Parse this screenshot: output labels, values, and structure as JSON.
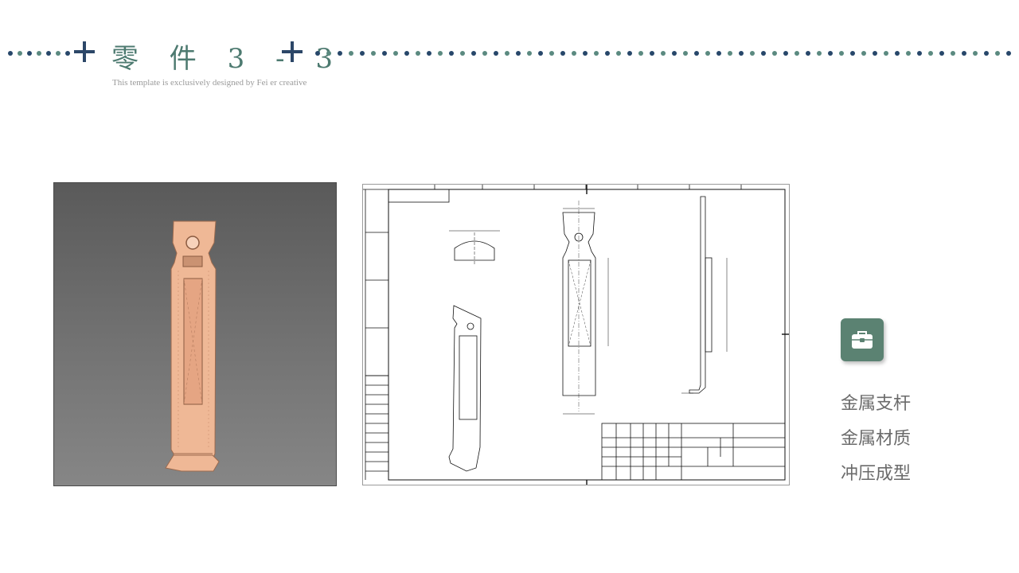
{
  "header": {
    "title": "零 件 3 - 3",
    "tagline": "This template is exclusively  designed  by Fei er creative"
  },
  "colors": {
    "title": "#4d7a70",
    "plus": "#2c4768",
    "dots_primary": "#27476a",
    "dots_secondary": "#5b8a80",
    "badge": "#5b8272",
    "feature_text": "#6b6b6b",
    "part_fill": "#efb896"
  },
  "badge": {
    "icon": "toolbox-icon"
  },
  "features": [
    "金属支杆",
    "金属材质",
    "冲压成型"
  ]
}
